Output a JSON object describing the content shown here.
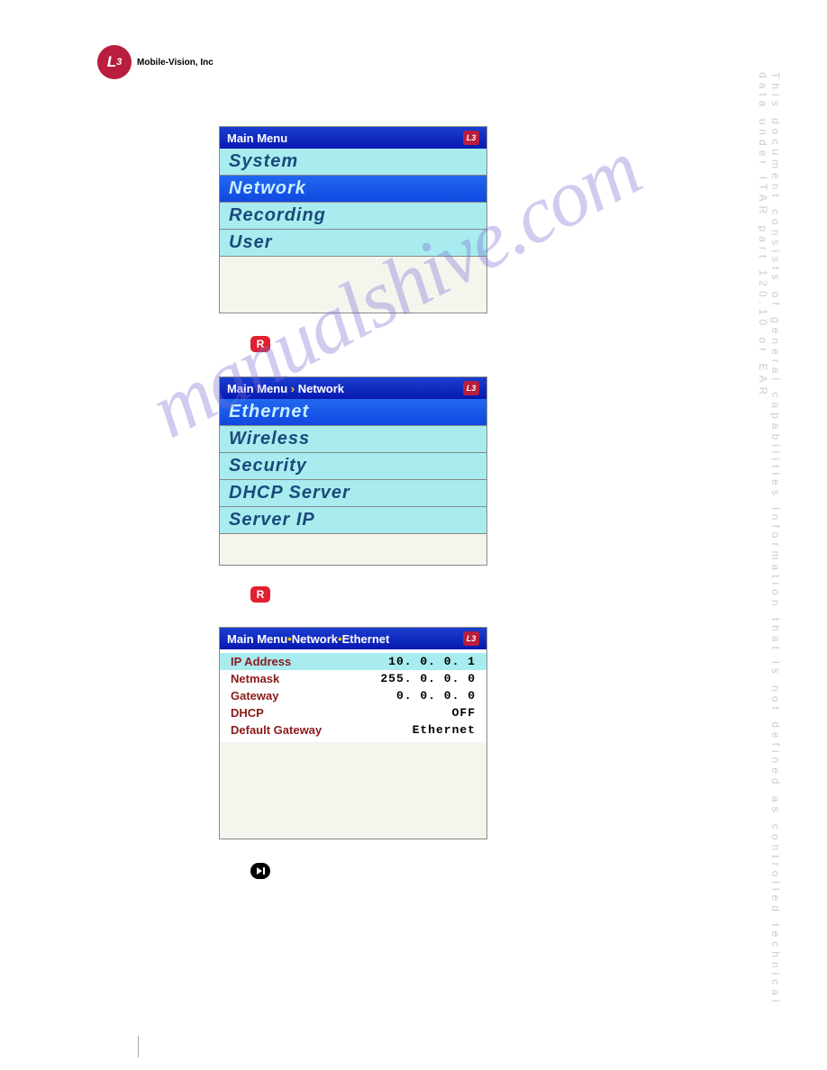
{
  "header": {
    "company": "Mobile-Vision, Inc",
    "logo_text": "L3"
  },
  "watermark": "manualshive.com",
  "side_disclaimer": "This document consists of general capabilities information that is not defined as controlled technical data under ITAR part 120.10 or EAR",
  "menu1": {
    "title": "Main Menu",
    "items": [
      "System",
      "Network",
      "Recording",
      "User"
    ],
    "selected_index": 1
  },
  "menu2": {
    "breadcrumb": [
      "Main Menu",
      "Network"
    ],
    "items": [
      "Ethernet",
      "Wireless",
      "Security",
      "DHCP Server",
      "Server IP"
    ],
    "selected_index": 0
  },
  "menu3": {
    "breadcrumb": [
      "Main Menu",
      "Network",
      "Ethernet"
    ],
    "rows": [
      {
        "label": "IP Address",
        "value": "10.  0.  0.  1",
        "selected": true
      },
      {
        "label": "Netmask",
        "value": "255.  0.  0.  0",
        "selected": false
      },
      {
        "label": "Gateway",
        "value": "0.  0.  0.  0",
        "selected": false
      },
      {
        "label": "DHCP",
        "value": "OFF",
        "selected": false
      },
      {
        "label": "Default Gateway",
        "value": "Ethernet",
        "selected": false
      }
    ]
  },
  "r_button": "R"
}
